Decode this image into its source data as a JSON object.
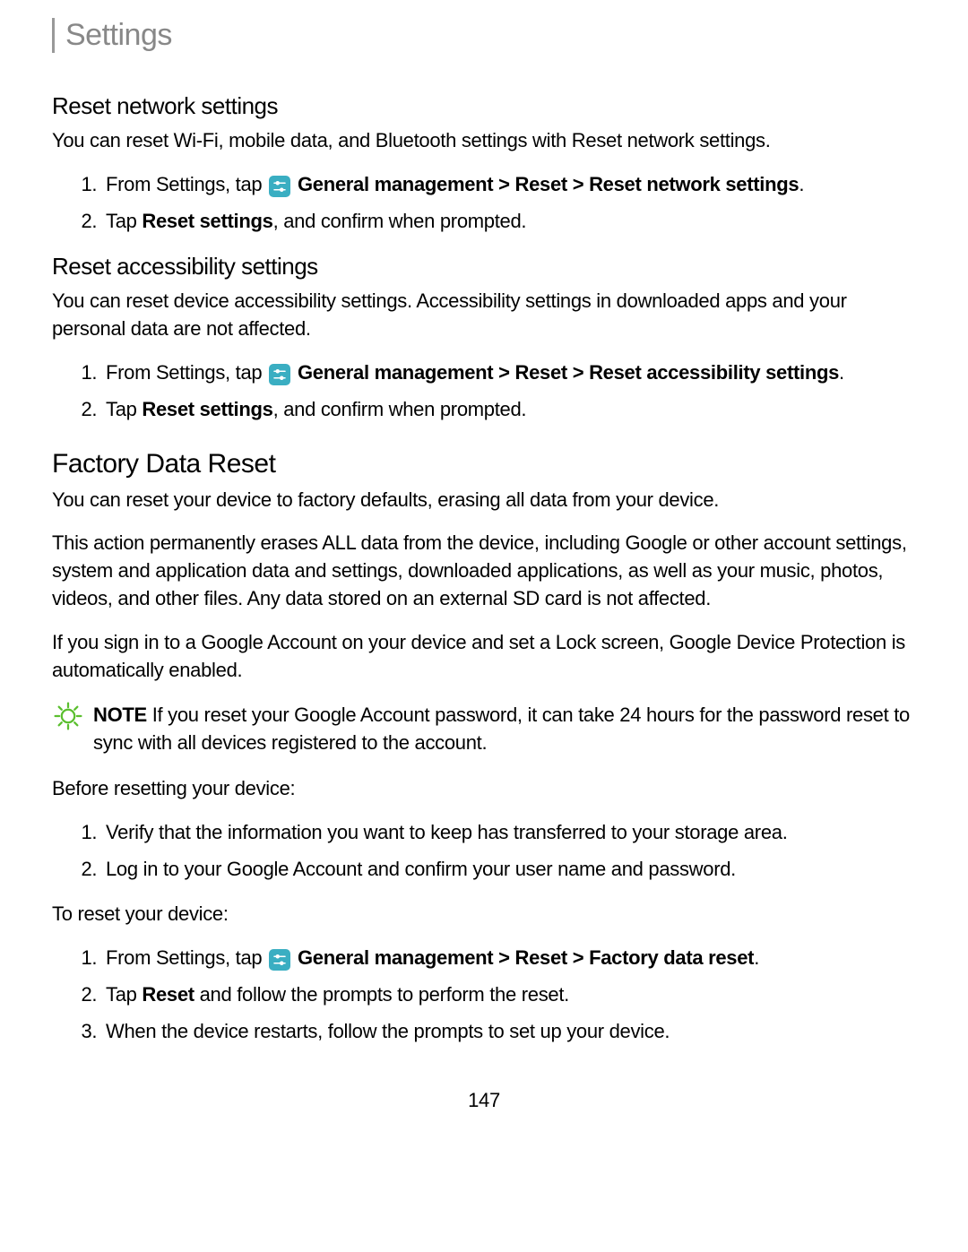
{
  "header": {
    "title": "Settings"
  },
  "sections": {
    "resetNetwork": {
      "heading": "Reset network settings",
      "intro": "You can reset Wi-Fi, mobile data, and Bluetooth settings with Reset network settings.",
      "step1_pre": "From Settings, tap ",
      "step1_bold": " General management > Reset > Reset network settings",
      "step1_post": ".",
      "step2_pre": "Tap ",
      "step2_bold": "Reset settings",
      "step2_post": ", and confirm when prompted."
    },
    "resetAccessibility": {
      "heading": "Reset accessibility settings",
      "intro": "You can reset device accessibility settings. Accessibility settings in downloaded apps and your personal data are not affected.",
      "step1_pre": "From Settings, tap ",
      "step1_bold": " General management > Reset > Reset accessibility settings",
      "step1_post": ".",
      "step2_pre": "Tap ",
      "step2_bold": "Reset settings",
      "step2_post": ", and confirm when prompted."
    },
    "factoryReset": {
      "heading": "Factory Data Reset",
      "para1": "You can reset your device to factory defaults, erasing all data from your device.",
      "para2": "This action permanently erases ALL data from the device, including Google or other account settings, system and application data and settings, downloaded applications, as well as your music, photos, videos, and other files. Any data stored on an external SD card is not affected.",
      "para3": "If you sign in to a Google Account on your device and set a Lock screen, Google Device Protection is automatically enabled.",
      "noteLabel": "NOTE",
      "noteText": "  If you reset your Google Account password, it can take 24 hours for the password reset to sync with all devices registered to the account.",
      "beforeResetting": "Before resetting your device:",
      "beforeStep1": "Verify that the information you want to keep has transferred to your storage area.",
      "beforeStep2": "Log in to your Google Account and confirm your user name and password.",
      "toReset": "To reset your device:",
      "resetStep1_pre": "From Settings, tap ",
      "resetStep1_bold": " General management > Reset > Factory data reset",
      "resetStep1_post": ".",
      "resetStep2_pre": "Tap ",
      "resetStep2_bold": "Reset",
      "resetStep2_post": " and follow the prompts to perform the reset.",
      "resetStep3": "When the device restarts, follow the prompts to set up your device."
    }
  },
  "pageNumber": "147"
}
